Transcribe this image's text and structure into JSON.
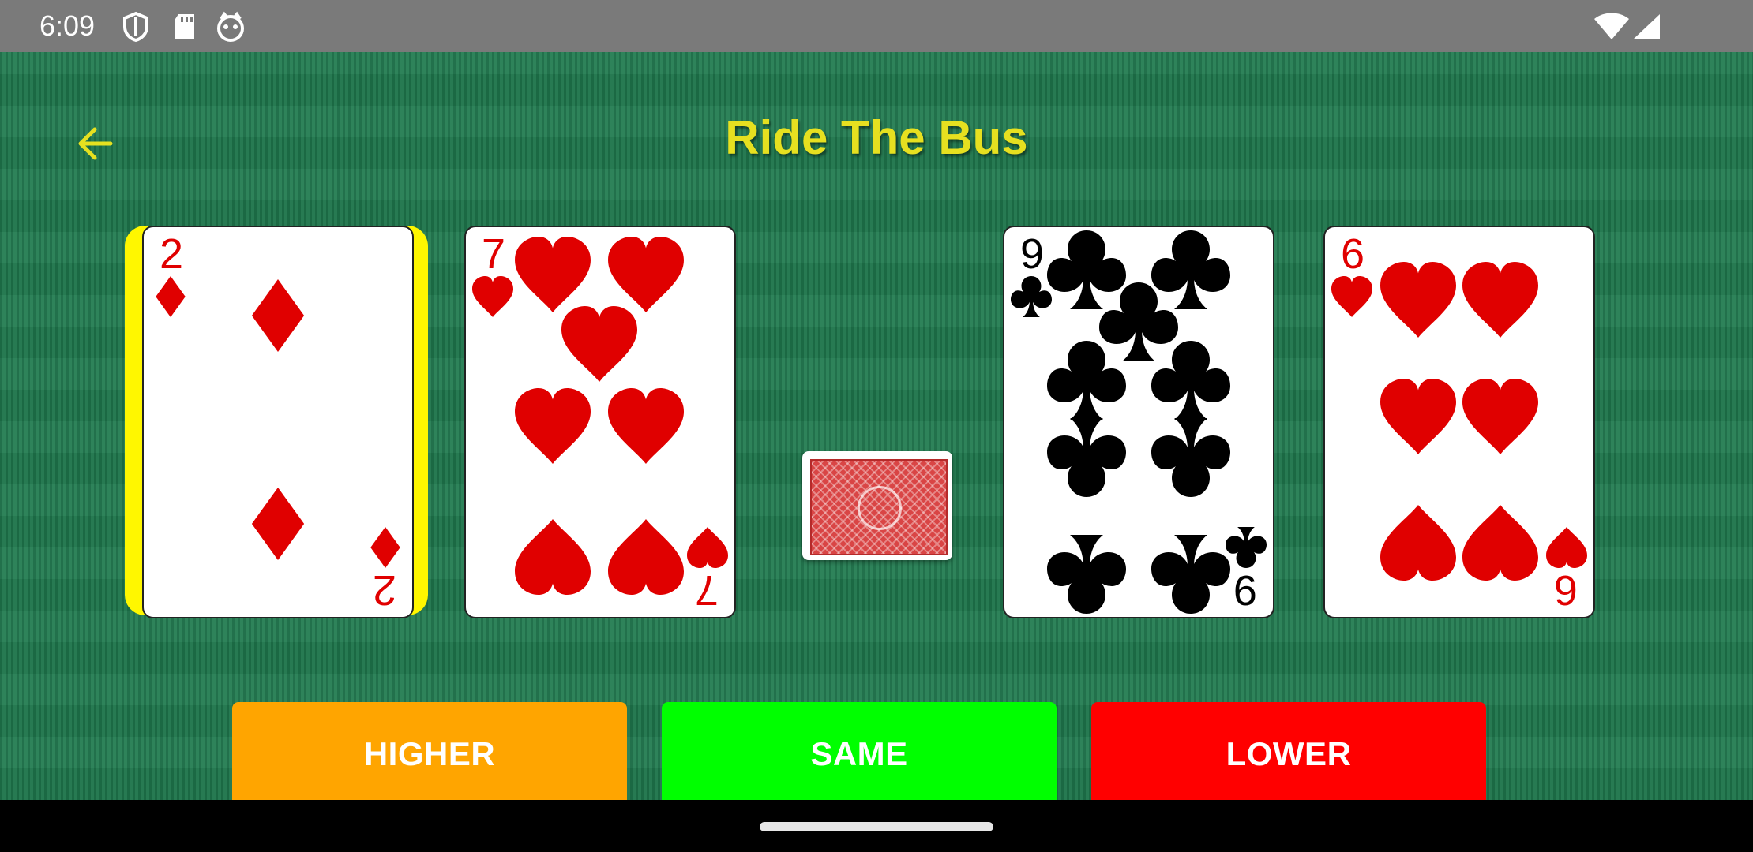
{
  "status_bar": {
    "time": "6:09",
    "icons": [
      "shield-icon",
      "sd-card-icon",
      "face-icon",
      "wifi-icon",
      "cell-signal-icon"
    ]
  },
  "header": {
    "title": "Ride The Bus",
    "back_icon": "arrow-left-icon",
    "title_color": "#e6e020"
  },
  "cards": [
    {
      "rank": "2",
      "suit": "diamonds",
      "color": "#e00000",
      "selected": true
    },
    {
      "rank": "7",
      "suit": "hearts",
      "color": "#e00000",
      "selected": false
    },
    {
      "rank": "9",
      "suit": "clubs",
      "color": "#000000",
      "selected": false
    },
    {
      "rank": "6",
      "suit": "hearts",
      "color": "#e00000",
      "selected": false
    }
  ],
  "deck": {
    "label": "card-back",
    "color": "#d94545"
  },
  "buttons": {
    "higher": {
      "label": "HIGHER",
      "color": "#ffa500"
    },
    "same": {
      "label": "SAME",
      "color": "#00ff00"
    },
    "lower": {
      "label": "LOWER",
      "color": "#ff0000"
    }
  },
  "colors": {
    "felt": "#1f7a4e",
    "highlight": "#fff700"
  }
}
